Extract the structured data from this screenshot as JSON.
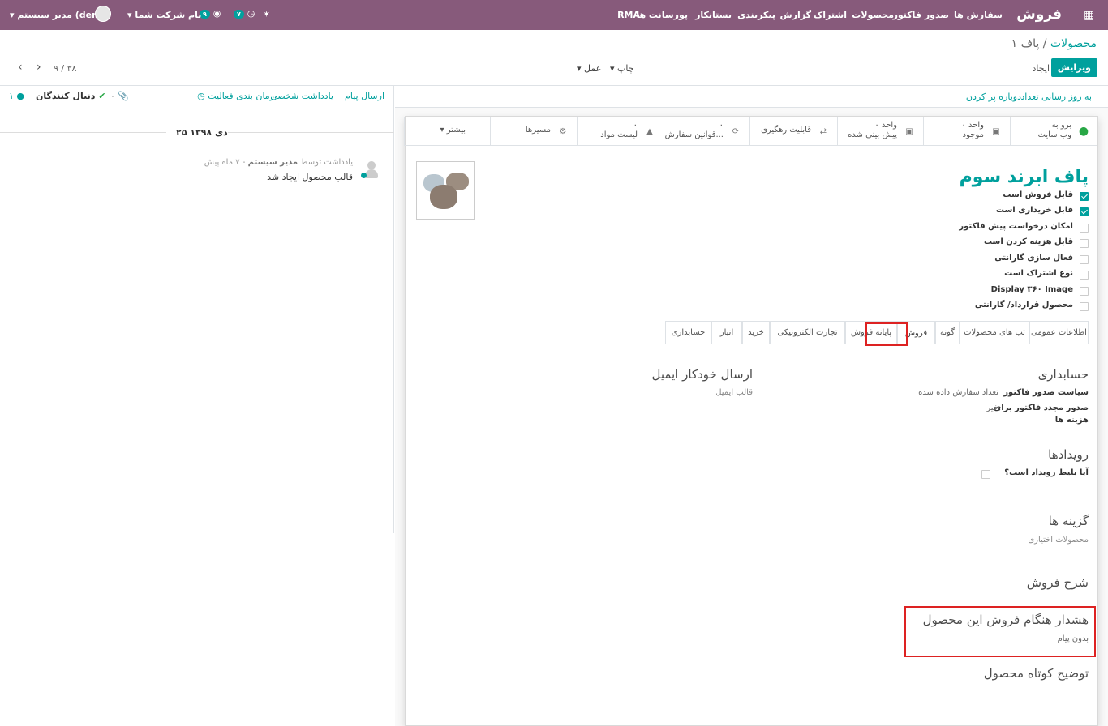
{
  "topbar": {
    "app": "فروش",
    "menu": [
      "سفارش ها",
      "صدور فاکتور",
      "محصولات",
      "اشتراک",
      "گزارش",
      "پیکربندی",
      "بستانکار",
      "پورسانت ها",
      "RMA"
    ],
    "activity_count": "۷",
    "message_count": "۹",
    "company": "نام شرکت شما",
    "user": "مدیر سیستم (demo)"
  },
  "breadcrumb": {
    "parent": "محصولات",
    "separator": "/",
    "current": "پاف ۱"
  },
  "buttons": {
    "edit": "ویرایش",
    "create": "ایجاد",
    "print": "چاپ",
    "action": "عمل"
  },
  "pager": "۹ / ۳۸",
  "statusbar": {
    "update_qty": "به روز رسانی تعداد",
    "replenish": "دوباره پر کردن"
  },
  "chatter": {
    "send_message": "ارسال پیام",
    "log_note": "یادداشت شخصی",
    "schedule": "زمان بندی فعالیت",
    "attachments": "۰",
    "follow": "دنبال کنندگان",
    "followers": "۱",
    "date_sep": "۲۵ دی ۱۳۹۸",
    "msg_prefix": "یادداشت توسط",
    "msg_author": "مدیر سیستم",
    "msg_time": "- ۷ ماه پیش",
    "msg_body": "قالب محصول ایجاد شد"
  },
  "smart": {
    "website_1": "برو به",
    "website_2": "وب سایت",
    "onhand_1": "۰ واحد",
    "onhand_2": "موجود",
    "forecast_1": "۰ واحد",
    "forecast_2": "پیش بینی شده",
    "traceability": "قابلیت رهگیری",
    "rules_1": "۰",
    "rules_2": "قوانین سفارش...",
    "bom_1": "۰",
    "bom_2": "لیست مواد",
    "routes": "مسیرها",
    "more": "بیشتر"
  },
  "product": {
    "name": "پاف ابرند سوم"
  },
  "flags": [
    {
      "label": "قابل فروش است",
      "checked": true
    },
    {
      "label": "قابل خریداری است",
      "checked": true
    },
    {
      "label": "امکان درخواست پیش فاکتور",
      "checked": false
    },
    {
      "label": "قابل هزینه کردن است",
      "checked": false
    },
    {
      "label": "فعال سازی گارانتی",
      "checked": false
    },
    {
      "label": "نوع اشتراک است",
      "checked": false
    },
    {
      "label": "Display ۳۶۰ Image",
      "checked": false
    },
    {
      "label": "محصول قرارداد/ گارانتی",
      "checked": false
    }
  ],
  "tabs": [
    "اطلاعات عمومی",
    "تب های محصولات",
    "گونه",
    "فروش",
    "پایانه فروش",
    "تجارت الکترونیکی",
    "خرید",
    "انبار",
    "حسابداری"
  ],
  "active_tab": "فروش",
  "sales": {
    "accounting_title": "حسابداری",
    "inv_policy_label": "سیاست صدور فاکتور",
    "inv_policy_value": "تعداد سفارش داده شده",
    "reinvoice_label_1": "صدور مجدد فاکتور برای",
    "reinvoice_label_2": "هزینه ها",
    "reinvoice_value": "خیر",
    "email_title": "ارسال خودکار ایمیل",
    "email_template": "قالب ایمیل",
    "events_title": "رویدادها",
    "event_ticket": "آیا بلیط رویداد است؟",
    "options_title": "گزینه ها",
    "optional_products": "محصولات اختیاری",
    "sale_desc_title": "شرح فروش",
    "warning_title": "هشدار هنگام فروش این محصول",
    "warning_value": "بدون پیام",
    "short_desc_title": "توضیح کوتاه محصول"
  },
  "colors": {
    "brand": "#875a7b",
    "accent": "#00a09d",
    "highlight": "#dd2222"
  }
}
